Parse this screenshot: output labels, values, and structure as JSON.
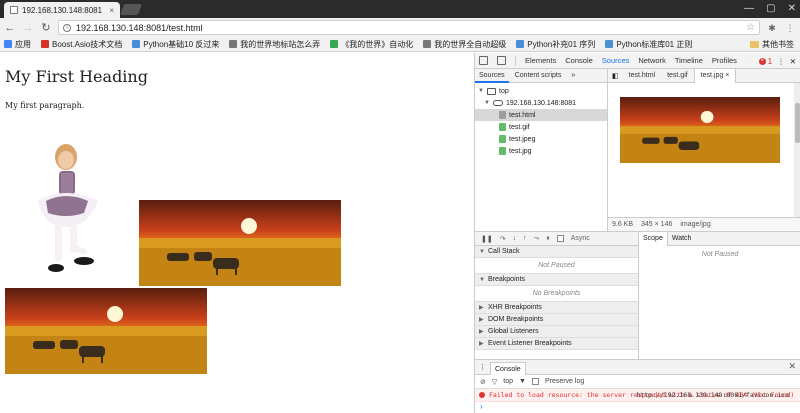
{
  "browser": {
    "tab_title": "192.168.130.148:8081",
    "tab_close": "×",
    "url": "192.168.130.148:8081/test.html",
    "bookmarks": [
      {
        "label": "应用",
        "color": "#4285f4"
      },
      {
        "label": "Boost.Asio技术文档",
        "color": "#d93025"
      },
      {
        "label": "Python基础10 反过来",
        "color": "#4a8fd8"
      },
      {
        "label": "我的世界地标站怎么弄",
        "color": "#777777"
      },
      {
        "label": "《我的世界》自动化",
        "color": "#34a853"
      },
      {
        "label": "我的世界全自动超级",
        "color": "#777777"
      },
      {
        "label": "Python补充01 序列",
        "color": "#4a8fd8"
      },
      {
        "label": "Python标准库01 正则",
        "color": "#4a8fd8"
      }
    ],
    "bookmarks_other": "其他书签"
  },
  "page": {
    "heading": "My First Heading",
    "paragraph": "My first paragraph."
  },
  "devtools": {
    "tabs": [
      "Elements",
      "Console",
      "Sources",
      "Network",
      "Timeline",
      "Profiles"
    ],
    "active_tab": "Sources",
    "error_count": "1",
    "navigator_tabs": [
      "Sources",
      "Content scripts",
      "»"
    ],
    "tree": {
      "top": "top",
      "host": "192.168.130.148:8081",
      "files": [
        {
          "name": "test.html",
          "color": "#9e9e9e"
        },
        {
          "name": "test.gif",
          "color": "#66bb6a"
        },
        {
          "name": "test.jpeg",
          "color": "#66bb6a"
        },
        {
          "name": "test.jpg",
          "color": "#66bb6a"
        }
      ]
    },
    "editor_tabs": [
      "test.html",
      "test.gif",
      "test.jpg"
    ],
    "editor_tab_close": "×",
    "preview_info": {
      "size": "9.6 KB",
      "dimensions": "345 × 146",
      "mime": "image/jpg"
    },
    "async_label": "Async",
    "sections": [
      {
        "title": "Call Stack",
        "body": "Not Paused"
      },
      {
        "title": "Breakpoints",
        "body": "No Breakpoints"
      },
      {
        "title": "XHR Breakpoints",
        "body": ""
      },
      {
        "title": "DOM Breakpoints",
        "body": ""
      },
      {
        "title": "Global Listeners",
        "body": ""
      },
      {
        "title": "Event Listener Breakpoints",
        "body": ""
      }
    ],
    "scope_tabs": [
      "Scope",
      "Watch"
    ],
    "scope_body": "Not Paused",
    "console": {
      "tab": "Console",
      "context": "top",
      "preserve_log": "Preserve log",
      "error_text": "Failed to load resource: the server responded with a status of 404 (Not Found)",
      "error_source": "http://192.168.130.148:8081/favicon.ico",
      "prompt": "›"
    }
  }
}
